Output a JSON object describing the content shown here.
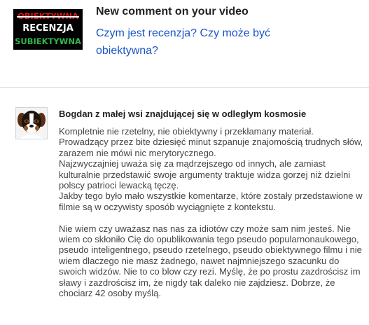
{
  "notification": {
    "thumbnail": {
      "line1": "OBIEKTYWNA",
      "line2": "RECENZJA",
      "line3": "SUBIEKTYWNA"
    },
    "title": "New comment on your video",
    "video_title": "Czym jest recenzja? Czy może być obiektywna?"
  },
  "comment": {
    "author": "Bogdan z małej wsi znajdującej się w odległym kosmosie",
    "avatar_icon": "bernese-dog-icon",
    "paragraph1": "Kompletnie nie rzetelny, nie obiektywny i przekłamany materiał. Prowadzący przez bite dziesięć minut szpanuje znajomością trudnych słów, zarazem nie mówi nic merytorycznego.\n Najzwyczajniej uważa się za mądrzejszego od innych, ale zamiast kulturalnie przedstawić swoje argumenty traktuje widza gorzej niż dzielni polscy patrioci lewacką tęczę.\nJakby tego było mało wszystkie komentarze, które zostały przedstawione w filmie są w oczywisty sposób wyciągnięte z kontekstu.",
    "paragraph2": "Nie wiem czy uważasz nas nas za idiotów czy może sam nim jesteś. Nie wiem co skłoniło Cię do opublikowania tego pseudo popularnonaukowego, pseudo inteligentnego, pseudo rzetelnego, pseudo obiektywnego filmu i nie wiem dlaczego nie masz żadnego, nawet najmniejszego szacunku do swoich widzów. Nie to co blow czy rezi. Myślę, że po prostu zazdrościsz im sławy i zazdrościsz im, że nigdy tak daleko nie zajdziesz. Dobrze, że chociarz 42 osoby myślą."
  },
  "colors": {
    "link": "#1a55c9",
    "thumbnail_red": "#e0161a",
    "thumbnail_green": "#2fb84a"
  }
}
